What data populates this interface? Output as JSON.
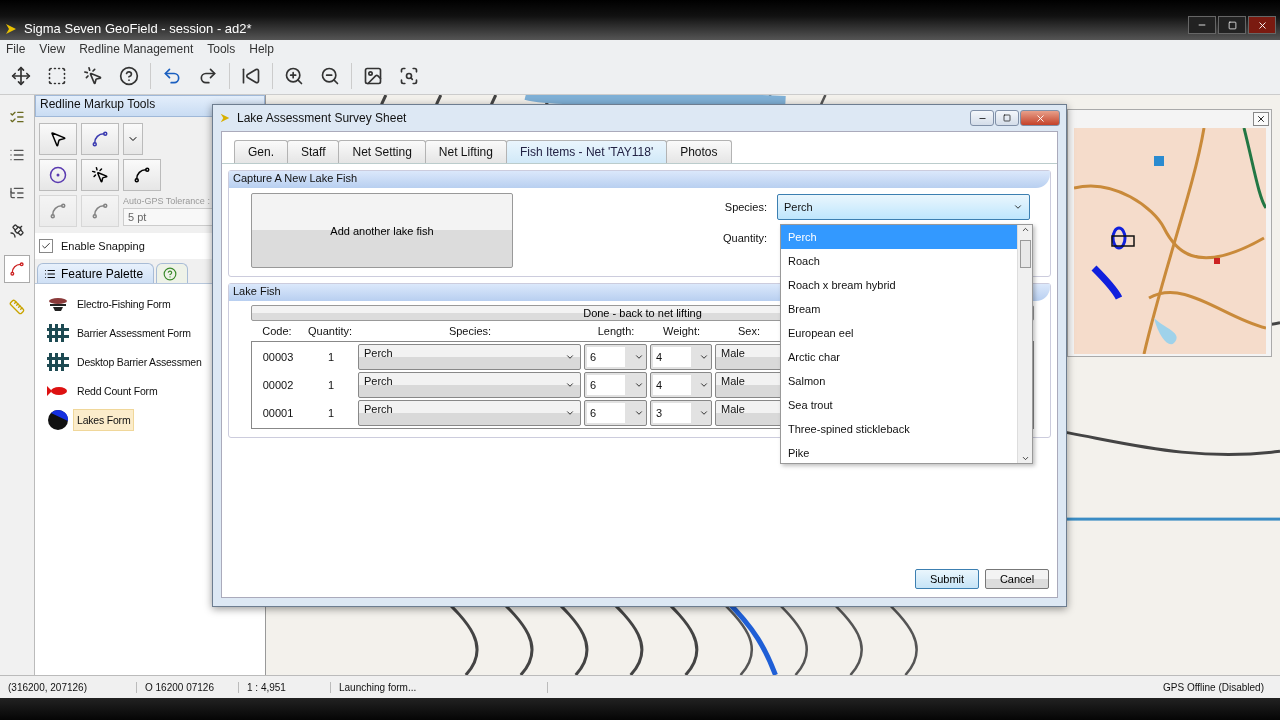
{
  "window": {
    "title": "Sigma Seven GeoField - session - ad2*"
  },
  "menu": [
    "File",
    "View",
    "Redline Management",
    "Tools",
    "Help"
  ],
  "side_tabs": [
    {
      "kind": "checklist",
      "selected": false
    },
    {
      "kind": "list",
      "selected": false
    },
    {
      "kind": "outline",
      "selected": false
    },
    {
      "kind": "gps",
      "selected": false
    },
    {
      "kind": "redline",
      "selected": true
    },
    {
      "kind": "ruler",
      "selected": false
    }
  ],
  "markup_panel": {
    "title": "Redline Markup Tools",
    "tolerance_label": "Auto-GPS Tolerance :",
    "tolerance_value": "5 pt",
    "snapping": {
      "label": "Enable Snapping",
      "checked": true
    }
  },
  "palette_tabs": [
    {
      "kind": "text",
      "label": "Feature Palette",
      "selected": true
    },
    {
      "kind": "help",
      "selected": false
    }
  ],
  "palette_items": [
    {
      "kind": "electro",
      "label": "Electro-Fishing Form",
      "selected": false
    },
    {
      "kind": "barrier",
      "label": "Barrier Assessment Form",
      "selected": false
    },
    {
      "kind": "barrier",
      "label": "Desktop Barrier Assessmen",
      "selected": false
    },
    {
      "kind": "redd",
      "label": "Redd Count Form",
      "selected": false
    },
    {
      "kind": "lake",
      "label": "Lakes Form",
      "selected": true
    }
  ],
  "dialog": {
    "title": "Lake Assessment Survey Sheet",
    "tabs": [
      {
        "label": "Gen.",
        "selected": false
      },
      {
        "label": "Staff",
        "selected": false
      },
      {
        "label": "Net Setting",
        "selected": false
      },
      {
        "label": "Net Lifting",
        "selected": false
      },
      {
        "label": "Fish Items - Net 'TAY118'",
        "selected": true
      },
      {
        "label": "Photos",
        "selected": false
      }
    ],
    "capture": {
      "title": "Capture A New Lake Fish",
      "add_button": "Add another lake fish",
      "species_label": "Species:",
      "species_value": "Perch",
      "quantity_label": "Quantity:"
    },
    "species_options": [
      {
        "label": "Perch",
        "selected": true
      },
      {
        "label": "Roach",
        "selected": false
      },
      {
        "label": "Roach x bream hybrid",
        "selected": false
      },
      {
        "label": "Bream",
        "selected": false
      },
      {
        "label": "European eel",
        "selected": false
      },
      {
        "label": "Arctic char",
        "selected": false
      },
      {
        "label": "Salmon",
        "selected": false
      },
      {
        "label": "Sea trout",
        "selected": false
      },
      {
        "label": "Three-spined stickleback",
        "selected": false
      },
      {
        "label": "Pike",
        "selected": false
      }
    ],
    "lake_fish": {
      "title": "Lake Fish",
      "done_button": "Done - back to net lifting",
      "columns": [
        "Code:",
        "Quantity:",
        "Species:",
        "Length:",
        "Weight:",
        "Sex:"
      ],
      "rows": [
        {
          "code": "00003",
          "quantity": "1",
          "species": "Perch",
          "length": "6",
          "weight": "4",
          "sex": "Male"
        },
        {
          "code": "00002",
          "quantity": "1",
          "species": "Perch",
          "length": "6",
          "weight": "4",
          "sex": "Male"
        },
        {
          "code": "00001",
          "quantity": "1",
          "species": "Perch",
          "length": "6",
          "weight": "3",
          "sex": "Male"
        }
      ]
    },
    "buttons": [
      {
        "label": "Submit",
        "default": true
      },
      {
        "label": "Cancel",
        "default": false
      }
    ]
  },
  "status_bar": {
    "cells": [
      "(316200, 207126)",
      "O 16200 07126",
      "1 : 4,951",
      "Launching form..."
    ],
    "gps": "GPS Offline (Disabled)"
  }
}
